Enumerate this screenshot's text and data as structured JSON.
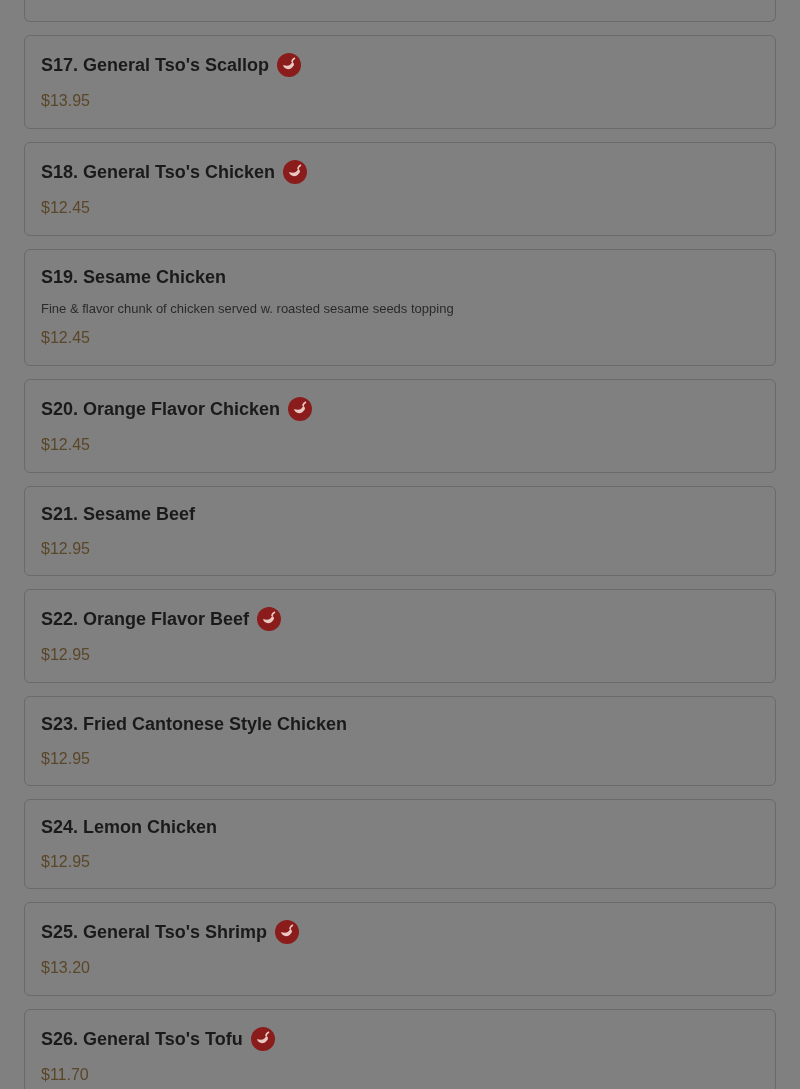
{
  "menu_items": [
    {
      "title": "S17. General Tso's Scallop",
      "spicy": true,
      "price": "$13.95"
    },
    {
      "title": "S18. General Tso's Chicken",
      "spicy": true,
      "price": "$12.45"
    },
    {
      "title": "S19. Sesame Chicken",
      "spicy": false,
      "description": "Fine & flavor chunk of chicken served w. roasted sesame seeds topping",
      "price": "$12.45"
    },
    {
      "title": "S20. Orange Flavor Chicken",
      "spicy": true,
      "price": "$12.45"
    },
    {
      "title": "S21. Sesame Beef",
      "spicy": false,
      "price": "$12.95"
    },
    {
      "title": "S22. Orange Flavor Beef",
      "spicy": true,
      "price": "$12.95"
    },
    {
      "title": "S23. Fried Cantonese Style Chicken",
      "spicy": false,
      "price": "$12.95"
    },
    {
      "title": "S24. Lemon Chicken",
      "spicy": false,
      "price": "$12.95"
    },
    {
      "title": "S25. General Tso's Shrimp",
      "spicy": true,
      "price": "$13.20"
    },
    {
      "title": "S26. General Tso's Tofu",
      "spicy": true,
      "price": "$11.70"
    }
  ]
}
